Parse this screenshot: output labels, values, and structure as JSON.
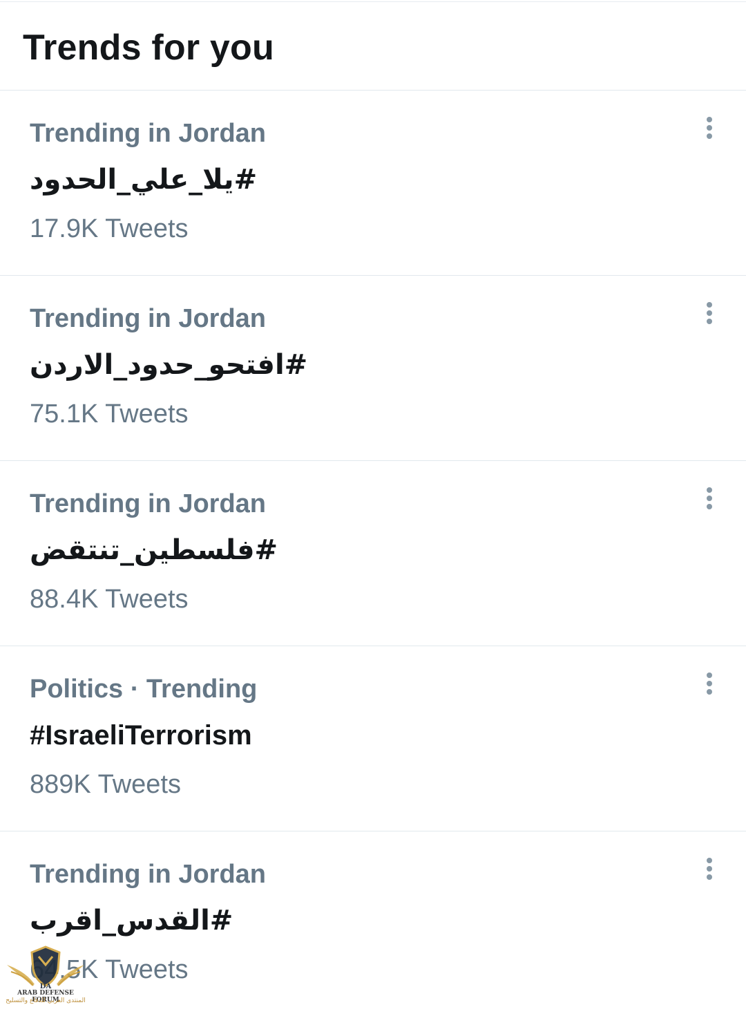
{
  "header": {
    "title": "Trends for you"
  },
  "trends": [
    {
      "context": "Trending in Jordan",
      "name": "#يلا_علي_الحدود",
      "count": "17.9K Tweets"
    },
    {
      "context": "Trending in Jordan",
      "name": "#افتحو_حدود_الاردن",
      "count": "75.1K Tweets"
    },
    {
      "context": "Trending in Jordan",
      "name": "#فلسطين_تنتقض",
      "count": "88.4K Tweets"
    },
    {
      "context": "Politics · Trending",
      "name": "#IsraeliTerrorism",
      "count": "889K Tweets"
    },
    {
      "context": "Trending in Jordan",
      "name": "#القدس_اقرب",
      "count": "64.5K Tweets"
    }
  ],
  "icons": {
    "more": "more-vertical-icon",
    "watermark_logo": "shield-wings-logo"
  },
  "watermark": {
    "monogram": "DA",
    "line1": "ARAB DEFENSE FORUM",
    "line2": "المنتدى العربي للدفاع والتسليح"
  },
  "colors": {
    "text_primary": "#14171a",
    "text_secondary": "#657786",
    "divider": "#e1e8ed",
    "icon": "#8899a6"
  }
}
